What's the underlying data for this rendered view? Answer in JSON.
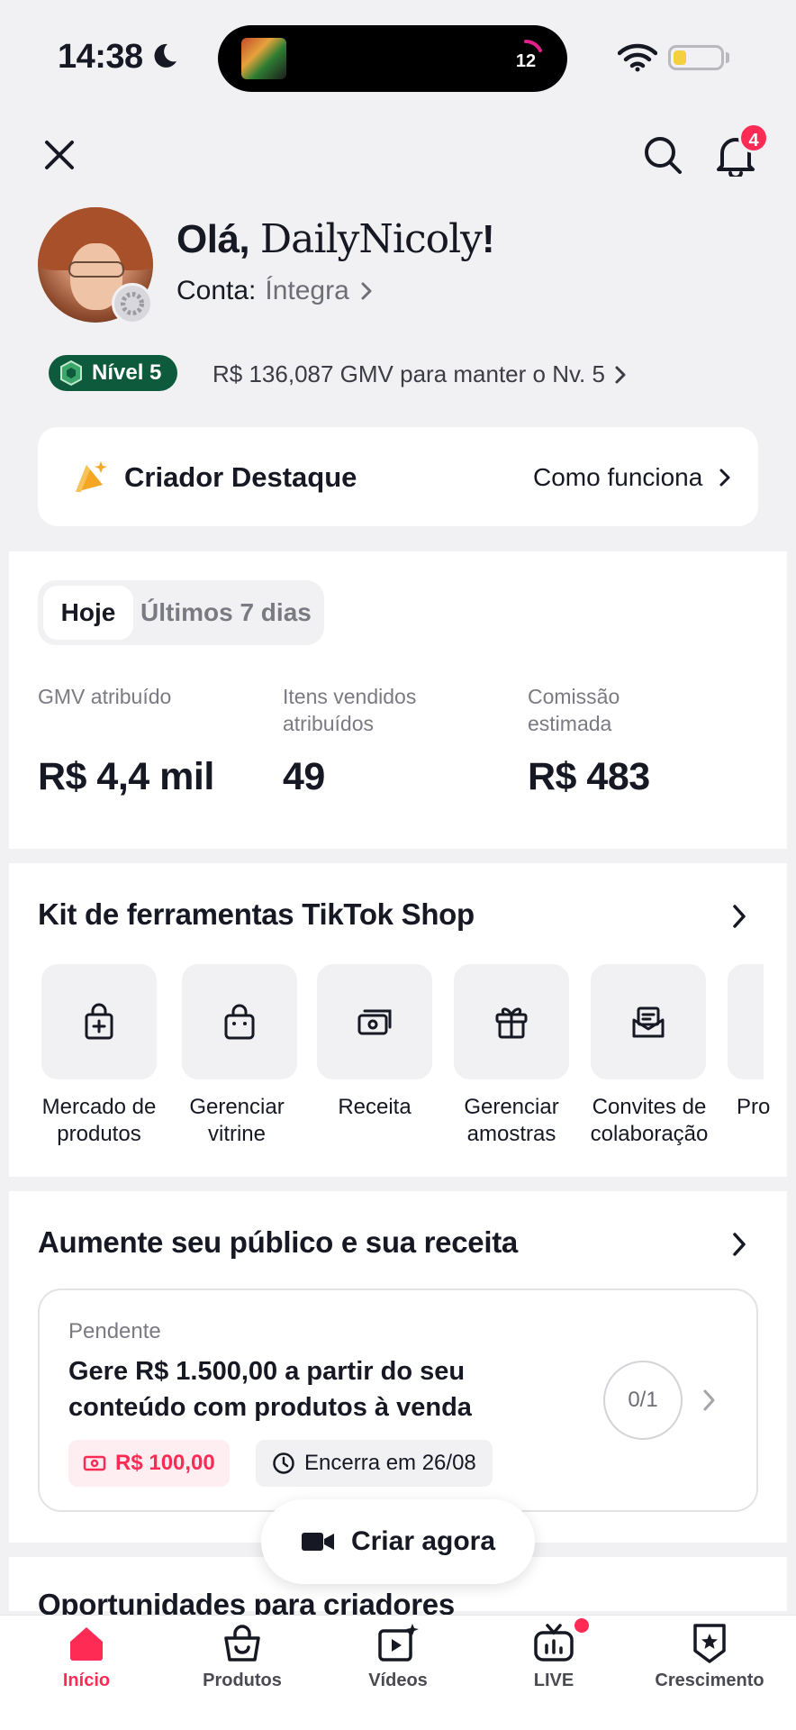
{
  "status_bar": {
    "time": "14:38",
    "island_count": "12"
  },
  "header": {
    "notification_count": "4"
  },
  "profile": {
    "greeting_prefix": "Olá, ",
    "username": "DailyNicoly",
    "greeting_suffix": "!",
    "account_label": "Conta:",
    "account_type": "Íntegra"
  },
  "level": {
    "badge": "Nível 5",
    "message": "R$ 136,087 GMV para manter o Nv. 5"
  },
  "creator_card": {
    "title": "Criador Destaque",
    "link": "Como funciona"
  },
  "stats": {
    "tabs": [
      "Hoje",
      "Últimos 7 dias"
    ],
    "active_tab": "Hoje",
    "items": [
      {
        "label": "GMV atribuído",
        "value": "R$ 4,4 mil"
      },
      {
        "label": "Itens vendidos atribuídos",
        "value": "49"
      },
      {
        "label": "Comissão estimada",
        "value": "R$ 483"
      }
    ]
  },
  "tools": {
    "title": "Kit de ferramentas TikTok Shop",
    "items": [
      {
        "label": "Mercado de produtos",
        "icon": "bag-plus-icon"
      },
      {
        "label": "Gerenciar vitrine",
        "icon": "shop-bag-icon"
      },
      {
        "label": "Receita",
        "icon": "cash-icon"
      },
      {
        "label": "Gerenciar amostras",
        "icon": "gift-icon"
      },
      {
        "label": "Convites de colaboração",
        "icon": "invite-envelope-icon"
      },
      {
        "label": "Pro",
        "icon": "tool-icon"
      }
    ]
  },
  "growth": {
    "title": "Aumente seu público e sua receita",
    "task": {
      "status": "Pendente",
      "title": "Gere R$ 1.500,00 a partir do seu conteúdo com produtos à venda",
      "reward": "R$ 100,00",
      "deadline": "Encerra em 26/08",
      "progress": "0/1"
    }
  },
  "create_button": "Criar agora",
  "opportunities_title": "Oportunidades para criadores",
  "tab_bar": [
    {
      "label": "Início",
      "icon": "home-icon",
      "active": true
    },
    {
      "label": "Produtos",
      "icon": "bag-icon",
      "active": false
    },
    {
      "label": "Vídeos",
      "icon": "video-icon",
      "active": false
    },
    {
      "label": "LIVE",
      "icon": "live-tv-icon",
      "active": false
    },
    {
      "label": "Crescimento",
      "icon": "star-badge-icon",
      "active": false
    }
  ],
  "colors": {
    "accent": "#fe2c55",
    "level_green": "#0e5a3c",
    "background": "#f1f1f3"
  }
}
